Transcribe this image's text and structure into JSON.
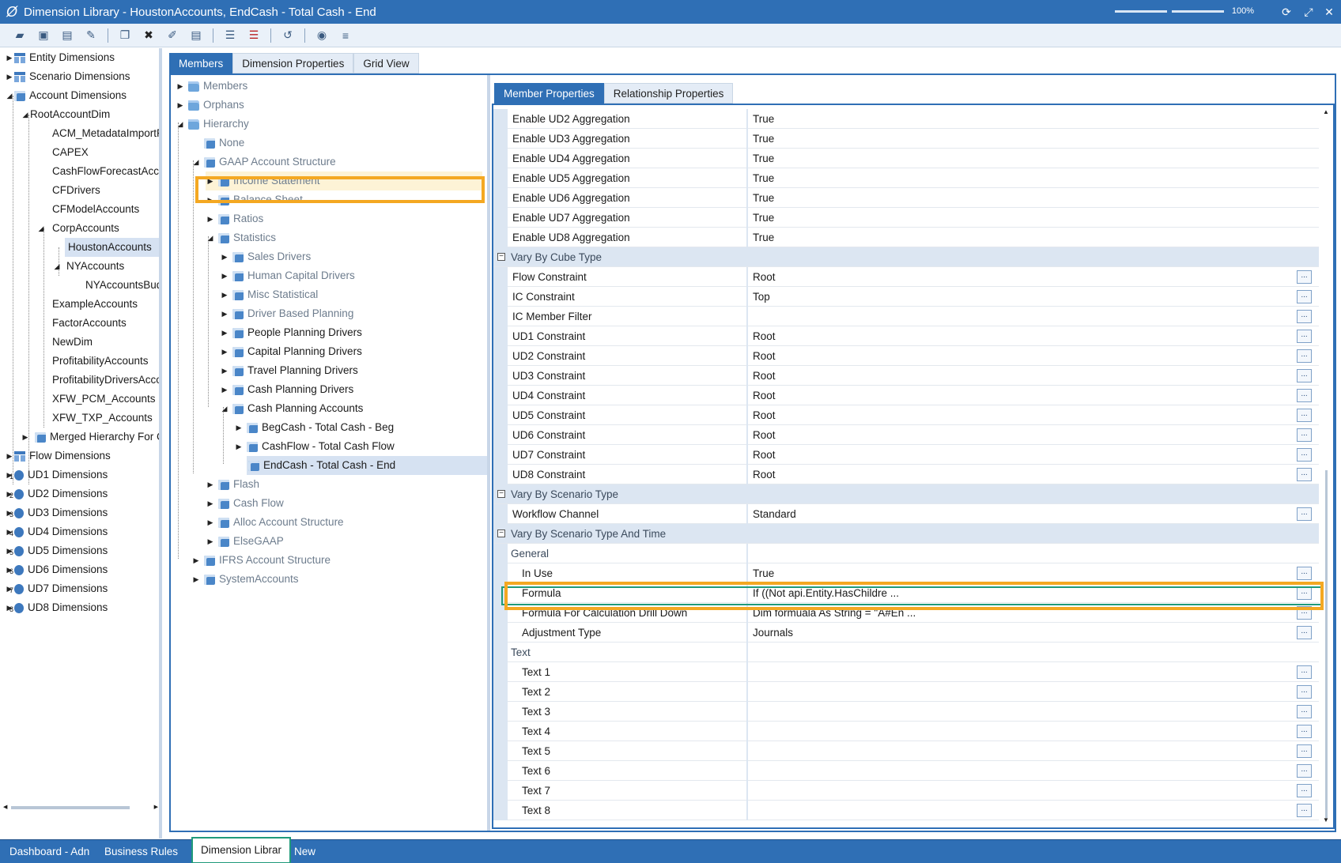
{
  "window": {
    "title": "Dimension Library - HoustonAccounts, EndCash - Total Cash - End",
    "zoom": "100%"
  },
  "toolbar": {
    "buttons": [
      "new-dimension",
      "delete-dimension",
      "save",
      "rename",
      "new-member",
      "delete-member",
      "edit",
      "save-member",
      "add-relationship",
      "remove-relationship",
      "refresh",
      "search",
      "collapse"
    ]
  },
  "left_tree": {
    "items": [
      {
        "label": "Entity Dimensions"
      },
      {
        "label": "Scenario Dimensions"
      },
      {
        "label": "Account Dimensions"
      },
      {
        "label": "RootAccountDim"
      },
      {
        "label": "ACM_MetadataImportF"
      },
      {
        "label": "CAPEX"
      },
      {
        "label": "CashFlowForecastAcco"
      },
      {
        "label": "CFDrivers"
      },
      {
        "label": "CFModelAccounts"
      },
      {
        "label": "CorpAccounts"
      },
      {
        "label": "HoustonAccounts"
      },
      {
        "label": "NYAccounts"
      },
      {
        "label": "NYAccountsBud"
      },
      {
        "label": "ExampleAccounts"
      },
      {
        "label": "FactorAccounts"
      },
      {
        "label": "NewDim"
      },
      {
        "label": "ProfitabilityAccounts"
      },
      {
        "label": "ProfitabilityDriversAcco"
      },
      {
        "label": "XFW_PCM_Accounts"
      },
      {
        "label": "XFW_TXP_Accounts"
      },
      {
        "label": "Merged Hierarchy For C"
      },
      {
        "label": "Flow Dimensions"
      },
      {
        "label": "UD1 Dimensions",
        "sup": "1"
      },
      {
        "label": "UD2 Dimensions",
        "sup": "2"
      },
      {
        "label": "UD3 Dimensions",
        "sup": "3"
      },
      {
        "label": "UD4 Dimensions",
        "sup": "4"
      },
      {
        "label": "UD5 Dimensions",
        "sup": "5"
      },
      {
        "label": "UD6 Dimensions",
        "sup": "6"
      },
      {
        "label": "UD7 Dimensions",
        "sup": "7"
      },
      {
        "label": "UD8 Dimensions",
        "sup": "8"
      }
    ]
  },
  "main_tabs": [
    "Members",
    "Dimension Properties",
    "Grid View"
  ],
  "member_tree": {
    "items": [
      {
        "label": "Members"
      },
      {
        "label": "Orphans"
      },
      {
        "label": "Hierarchy"
      },
      {
        "label": "None"
      },
      {
        "label": "GAAP Account Structure"
      },
      {
        "label": "Income Statement"
      },
      {
        "label": "Balance Sheet"
      },
      {
        "label": "Ratios"
      },
      {
        "label": "Statistics"
      },
      {
        "label": "Sales Drivers"
      },
      {
        "label": "Human Capital Drivers"
      },
      {
        "label": "Misc Statistical"
      },
      {
        "label": "Driver Based Planning"
      },
      {
        "label": "People Planning Drivers"
      },
      {
        "label": "Capital Planning Drivers"
      },
      {
        "label": "Travel Planning Drivers"
      },
      {
        "label": "Cash Planning Drivers"
      },
      {
        "label": "Cash Planning Accounts"
      },
      {
        "label": "BegCash - Total Cash - Beg"
      },
      {
        "label": "CashFlow - Total Cash Flow"
      },
      {
        "label": "EndCash - Total Cash - End"
      },
      {
        "label": "Flash"
      },
      {
        "label": "Cash Flow"
      },
      {
        "label": "Alloc Account Structure"
      },
      {
        "label": "ElseGAAP"
      },
      {
        "label": "IFRS Account Structure"
      },
      {
        "label": "SystemAccounts"
      }
    ]
  },
  "property_tabs": [
    "Member Properties",
    "Relationship Properties"
  ],
  "properties": {
    "rows": [
      {
        "name": "Enable UD2 Aggregation",
        "value": "True"
      },
      {
        "name": "Enable UD3 Aggregation",
        "value": "True"
      },
      {
        "name": "Enable UD4 Aggregation",
        "value": "True"
      },
      {
        "name": "Enable UD5 Aggregation",
        "value": "True"
      },
      {
        "name": "Enable UD6 Aggregation",
        "value": "True"
      },
      {
        "name": "Enable UD7 Aggregation",
        "value": "True"
      },
      {
        "name": "Enable UD8 Aggregation",
        "value": "True"
      },
      {
        "name": "Vary By Cube Type",
        "value": ""
      },
      {
        "name": "Flow Constraint",
        "value": "Root"
      },
      {
        "name": "IC Constraint",
        "value": "Top"
      },
      {
        "name": "IC Member Filter",
        "value": ""
      },
      {
        "name": "UD1 Constraint",
        "value": "Root"
      },
      {
        "name": "UD2 Constraint",
        "value": "Root"
      },
      {
        "name": "UD3 Constraint",
        "value": "Root"
      },
      {
        "name": "UD4 Constraint",
        "value": "Root"
      },
      {
        "name": "UD5 Constraint",
        "value": "Root"
      },
      {
        "name": "UD6 Constraint",
        "value": "Root"
      },
      {
        "name": "UD7 Constraint",
        "value": "Root"
      },
      {
        "name": "UD8 Constraint",
        "value": "Root"
      },
      {
        "name": "Vary By Scenario Type",
        "value": ""
      },
      {
        "name": "Workflow Channel",
        "value": "Standard"
      },
      {
        "name": "Vary By Scenario Type And Time",
        "value": ""
      },
      {
        "name": "General",
        "value": ""
      },
      {
        "name": "In Use",
        "value": "True"
      },
      {
        "name": "Formula",
        "value": "If ((Not api.Entity.HasChildre ..."
      },
      {
        "name": "Formula For Calculation Drill Down",
        "value": "Dim formuala As String = \"A#En ..."
      },
      {
        "name": "Adjustment Type",
        "value": "Journals"
      },
      {
        "name": "Text",
        "value": ""
      },
      {
        "name": "Text 1",
        "value": ""
      },
      {
        "name": "Text 2",
        "value": ""
      },
      {
        "name": "Text 3",
        "value": ""
      },
      {
        "name": "Text 4",
        "value": ""
      },
      {
        "name": "Text 5",
        "value": ""
      },
      {
        "name": "Text 6",
        "value": ""
      },
      {
        "name": "Text 7",
        "value": ""
      },
      {
        "name": "Text 8",
        "value": ""
      }
    ],
    "ellipsis": "..."
  },
  "bottom_tabs": [
    "Dashboard - Adn",
    "Business Rules",
    "Dimension Librar",
    "New"
  ],
  "colors": {
    "accent": "#2f6fb5",
    "highlight_orange": "#f4a822",
    "highlight_green": "#1f9a7a"
  }
}
